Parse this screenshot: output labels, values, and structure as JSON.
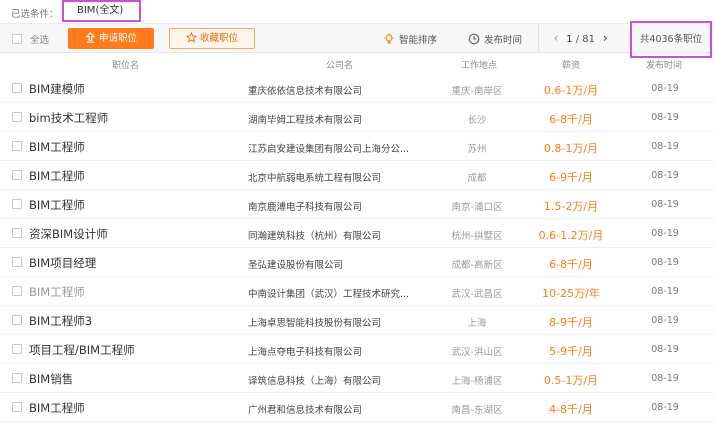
{
  "filter": {
    "label": "已选条件：",
    "tag": "BIM(全文)"
  },
  "toolbar": {
    "select_all": "全选",
    "apply_button": "申请职位",
    "favorite_button": "收藏职位",
    "smart_sort": "智能排序",
    "time_sort": "发布时间",
    "pager": {
      "prev": "‹",
      "current": "1",
      "separator": " / ",
      "total": "81",
      "next": "›"
    },
    "total_count": "共4036条职位"
  },
  "table": {
    "headers": {
      "title": "职位名",
      "company": "公司名",
      "location": "工作地点",
      "salary": "薪资",
      "date": "发布时间"
    },
    "rows": [
      {
        "title": "BIM建模师",
        "company": "重庆依依信息技术有限公司",
        "location": "重庆-南岸区",
        "salary": "0.6-1万/月",
        "date": "08-19"
      },
      {
        "title": "bim技术工程师",
        "company": "湖南毕姆工程技术有限公司",
        "location": "长沙",
        "salary": "6-8千/月",
        "date": "08-19"
      },
      {
        "title": "BIM工程师",
        "company": "江苏启安建设集团有限公司上海分公...",
        "location": "苏州",
        "salary": "0.8-1万/月",
        "date": "08-19"
      },
      {
        "title": "BIM工程师",
        "company": "北京中航弱电系统工程有限公司",
        "location": "成都",
        "salary": "6-9千/月",
        "date": "08-19"
      },
      {
        "title": "BIM工程师",
        "company": "南京鹿溥电子科技有限公司",
        "location": "南京-浦口区",
        "salary": "1.5-2万/月",
        "date": "08-19"
      },
      {
        "title": "资深BIM设计师",
        "company": "同瀚建筑科技（杭州）有限公司",
        "location": "杭州-拱墅区",
        "salary": "0.6-1.2万/月",
        "date": "08-19"
      },
      {
        "title": "BIM项目经理",
        "company": "圣弘建设股份有限公司",
        "location": "成都-高新区",
        "salary": "6-8千/月",
        "date": "08-19"
      },
      {
        "title": "BIM工程师",
        "company": "中南设计集团（武汉）工程技术研究...",
        "location": "武汉-武昌区",
        "salary": "10-25万/年",
        "date": "08-19"
      },
      {
        "title": "BIM工程师3",
        "company": "上海卓思智能科技股份有限公司",
        "location": "上海",
        "salary": "8-9千/月",
        "date": "08-19"
      },
      {
        "title": "项目工程/BIM工程师",
        "company": "上海点夺电子科技有限公司",
        "location": "武汉-洪山区",
        "salary": "5-9千/月",
        "date": "08-19"
      },
      {
        "title": "BIM销售",
        "company": "译筑信息科技（上海）有限公司",
        "location": "上海-杨浦区",
        "salary": "0.5-1万/月",
        "date": "08-19"
      },
      {
        "title": "BIM工程师",
        "company": "广州君和信息技术有限公司",
        "location": "南昌-东湖区",
        "salary": "4-8千/月",
        "date": "08-19"
      }
    ]
  },
  "colors": {
    "accent": "#ff7b1c",
    "salary": "#ff7a1a",
    "highlight_border": "#c452d2"
  }
}
